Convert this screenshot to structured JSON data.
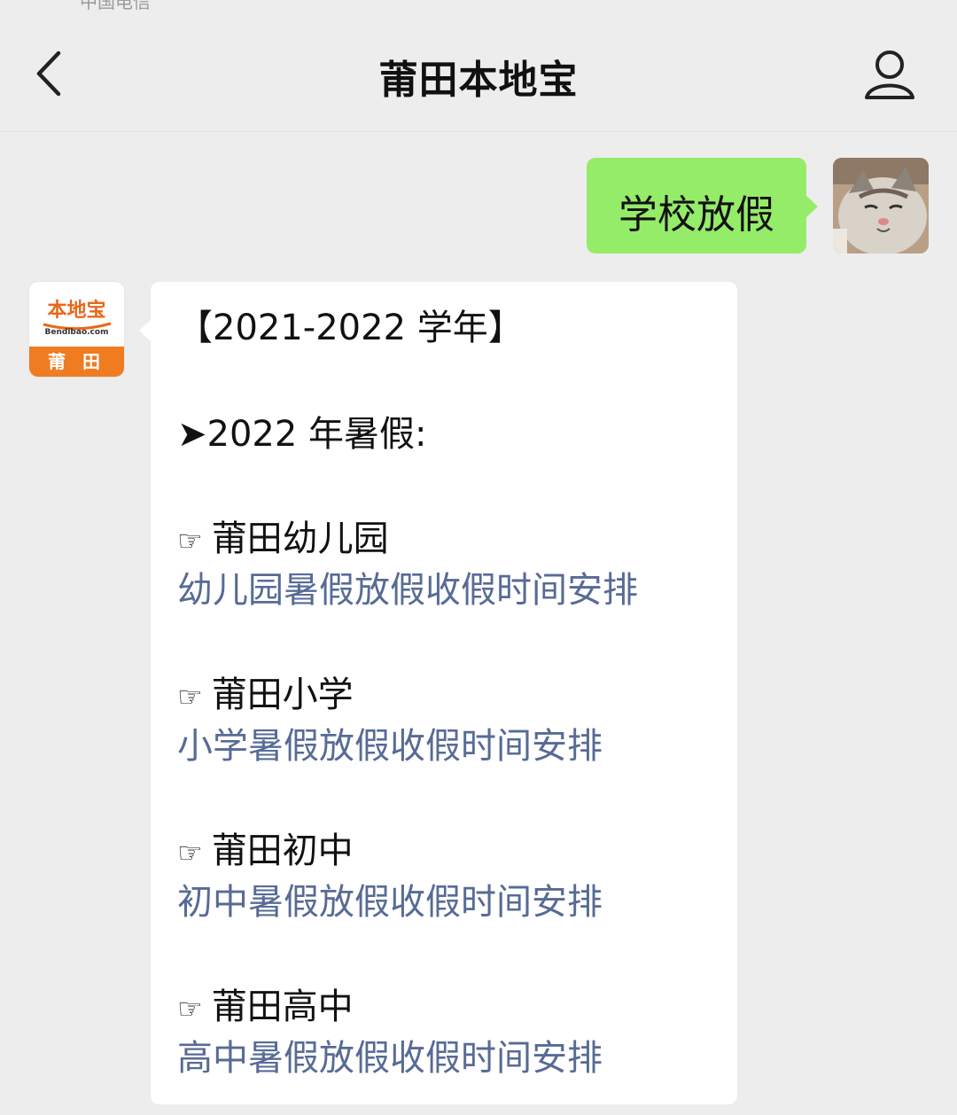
{
  "status_bar": {
    "text": "中国电信"
  },
  "header": {
    "title": "莆田本地宝"
  },
  "user_message": {
    "text": "学校放假"
  },
  "bot_avatar": {
    "brand": "本地宝",
    "url": "Bendibao.com",
    "city": "莆 田"
  },
  "reply": {
    "heading": "【2021-2022 学年】",
    "subheading": "➤2022 年暑假:",
    "hand_glyph": "☞",
    "sections": [
      {
        "label": "莆田幼儿园",
        "link": "幼儿园暑假放假收假时间安排"
      },
      {
        "label": "莆田小学",
        "link": "小学暑假放假收假时间安排"
      },
      {
        "label": "莆田初中",
        "link": "初中暑假放假收假时间安排"
      },
      {
        "label": "莆田高中",
        "link": "高中暑假放假收假时间安排"
      }
    ]
  },
  "colors": {
    "background": "#ededed",
    "sent_bubble": "#95ec69",
    "received_bubble": "#ffffff",
    "link": "#576b95",
    "brand_orange": "#f07c22"
  },
  "icons": [
    "chevron-left-icon",
    "user-profile-icon"
  ]
}
